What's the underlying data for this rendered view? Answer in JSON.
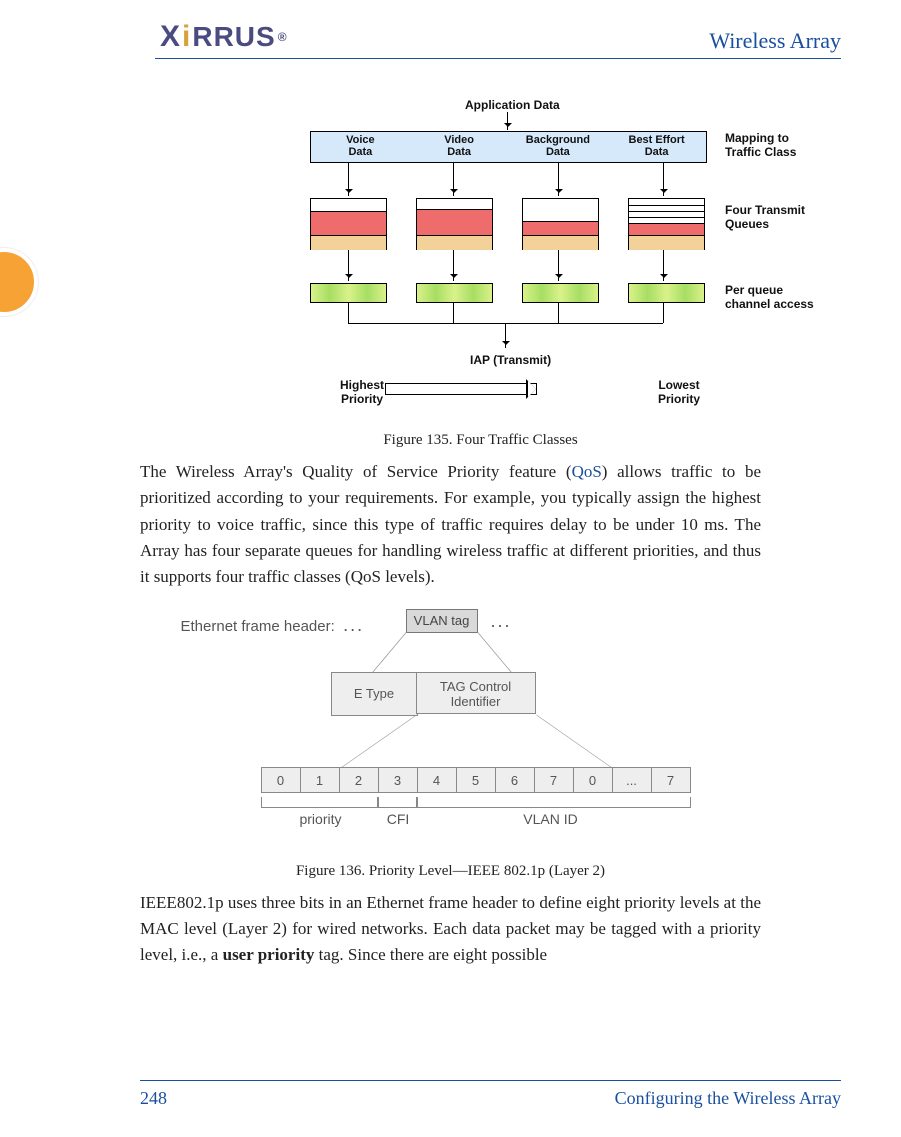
{
  "header": {
    "logo_text": "XIRRUS",
    "doc_title": "Wireless Array"
  },
  "fig135": {
    "app_data": "Application Data",
    "mapping": {
      "col1_a": "Voice",
      "col1_b": "Data",
      "col2_a": "Video",
      "col2_b": "Data",
      "col3_a": "Background",
      "col3_b": "Data",
      "col4_a": "Best Effort",
      "col4_b": "Data"
    },
    "right_labels": {
      "mapping_a": "Mapping to",
      "mapping_b": "Traffic Class",
      "queues_a": "Four Transmit",
      "queues_b": "Queues",
      "access_a": "Per queue",
      "access_b": "channel access"
    },
    "iap": "IAP (Transmit)",
    "highest_a": "Highest",
    "highest_b": "Priority",
    "lowest_a": "Lowest",
    "lowest_b": "Priority",
    "caption": "Figure 135. Four Traffic Classes"
  },
  "para1": {
    "t1": "The Wireless Array's Quality of Service Priority feature (",
    "link": "QoS",
    "t2": ") allows traffic to be prioritized according to your requirements. For example, you typically assign the highest priority to voice traffic, since this type of traffic requires delay to be under 10 ms. The Array has four separate queues for handling wireless traffic at different priorities, and thus it supports four traffic classes (QoS levels)."
  },
  "fig136": {
    "eth_label": "Ethernet frame header:",
    "dots1": "...",
    "vlan_tag": "VLAN tag",
    "dots2": "...",
    "etype": "E Type",
    "tci_a": "TAG Control",
    "tci_b": "Identifier",
    "bits": [
      "0",
      "1",
      "2",
      "3",
      "4",
      "5",
      "6",
      "7",
      "0",
      "...",
      "7"
    ],
    "sub_priority": "priority",
    "sub_cfi": "CFI",
    "sub_vlan": "VLAN ID",
    "caption": "Figure 136. Priority Level—IEEE 802.1p (Layer 2)"
  },
  "para2": {
    "t1": "IEEE802.1p uses three bits in an Ethernet frame header to define eight priority levels at the MAC level (Layer 2) for wired networks. Each data packet may be tagged with a priority level, i.e., a ",
    "bold": "user priority",
    "t2": " tag. Since there are eight possible"
  },
  "footer": {
    "page": "248",
    "section": "Configuring the Wireless Array"
  }
}
